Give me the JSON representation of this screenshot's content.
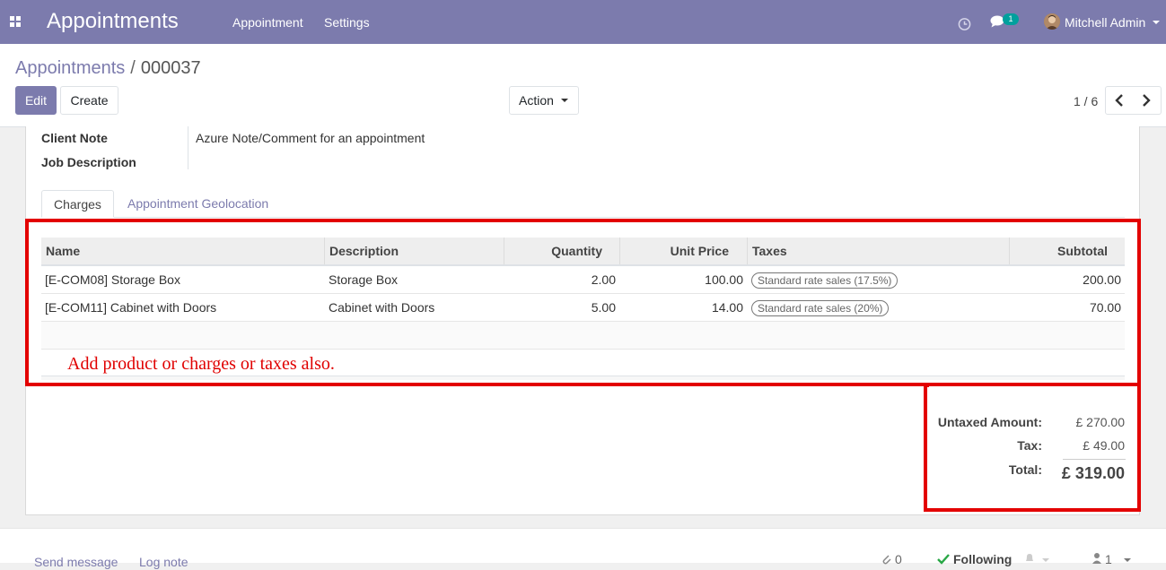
{
  "navbar": {
    "app_title": "Appointments",
    "menus": [
      "Appointment",
      "Settings"
    ],
    "chat_badge": "1",
    "user_name": "Mitchell Admin"
  },
  "breadcrumb": {
    "parent": "Appointments",
    "separator": "/",
    "current": "000037"
  },
  "toolbar": {
    "edit_label": "Edit",
    "create_label": "Create",
    "action_label": "Action",
    "pager": "1 / 6"
  },
  "form": {
    "client_note_label": "Client Note",
    "client_note_value": "Azure Note/Comment for an appointment",
    "job_description_label": "Job Description"
  },
  "tabs": [
    {
      "label": "Charges",
      "active": true
    },
    {
      "label": "Appointment Geolocation",
      "active": false
    }
  ],
  "table": {
    "headers": [
      "Name",
      "Description",
      "Quantity",
      "Unit Price",
      "Taxes",
      "Subtotal"
    ],
    "rows": [
      {
        "name": "[E-COM08] Storage Box",
        "description": "Storage Box",
        "quantity": "2.00",
        "unit_price": "100.00",
        "tax": "Standard rate sales (17.5%)",
        "subtotal": "200.00"
      },
      {
        "name": "[E-COM11] Cabinet with Doors",
        "description": "Cabinet with Doors",
        "quantity": "5.00",
        "unit_price": "14.00",
        "tax": "Standard rate sales (20%)",
        "subtotal": "70.00"
      }
    ]
  },
  "annotation": "Add product or charges or taxes also.",
  "totals": {
    "untaxed_label": "Untaxed Amount:",
    "untaxed_value": "£ 270.00",
    "tax_label": "Tax:",
    "tax_value": "£ 49.00",
    "total_label": "Total:",
    "total_value": "£ 319.00"
  },
  "chatter": {
    "send_message": "Send message",
    "log_note": "Log note",
    "attachments": "0",
    "following": "Following",
    "followers": "1"
  },
  "colors": {
    "brand": "#7c7bad",
    "annotation_red": "#e30000",
    "badge": "#00a09d"
  }
}
